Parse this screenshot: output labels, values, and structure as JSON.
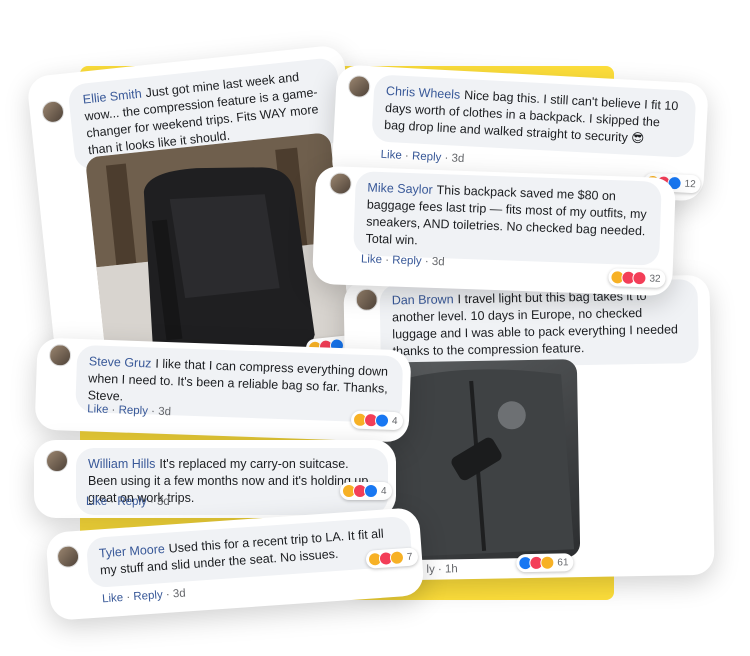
{
  "comments": [
    {
      "name": "Ellie Smith",
      "text": "Just got mine last week and wow... the compression feature is a game-changer for weekend trips. Fits WAY more than it looks like it should.",
      "reactions": "83"
    },
    {
      "name": "Chris Wheels",
      "text": "Nice bag this. I still can't believe I fit 10 days worth of clothes in a backpack. I skipped the bag drop line and walked straight to security 😎",
      "like": "Like",
      "reply": "Reply",
      "time": "3d",
      "reactions": "12"
    },
    {
      "name": "Mike Saylor",
      "text": "This backpack saved me $80 on baggage fees last trip — fits most of my outfits, my sneakers, AND toiletries. No checked bag needed. Total win.",
      "like": "Like",
      "reply": "Reply",
      "time": "3d",
      "reactions": "32"
    },
    {
      "name": "Dan Brown",
      "text": "I travel light but this bag takes it to another level. 10 days in Europe, no checked luggage and I was able to pack everything I needed thanks to the compression feature.",
      "time_partial": "ly · 1h",
      "reactions": "61"
    },
    {
      "name": "Steve Gruz",
      "text": "I like that I can compress everything down when I need to. It's been a reliable bag so far. Thanks, Steve.",
      "like": "Like",
      "reply": "Reply",
      "time": "3d",
      "reactions": "4"
    },
    {
      "name": "William Hills",
      "text": "It's replaced my carry-on suitcase. Been using it a few months now and it's holding up great on work trips.",
      "like": "Like",
      "reply": "Reply",
      "time": "3d",
      "reactions": "4"
    },
    {
      "name": "Tyler Moore",
      "text": "Used this for a recent trip to LA. It fit all my stuff and slid under the seat. No issues.",
      "like": "Like",
      "reply": "Reply",
      "time": "3d",
      "reactions": "7"
    }
  ],
  "colors": {
    "accent": "#fedf3b",
    "name": "#385898",
    "bubble": "#f0f2f5"
  }
}
